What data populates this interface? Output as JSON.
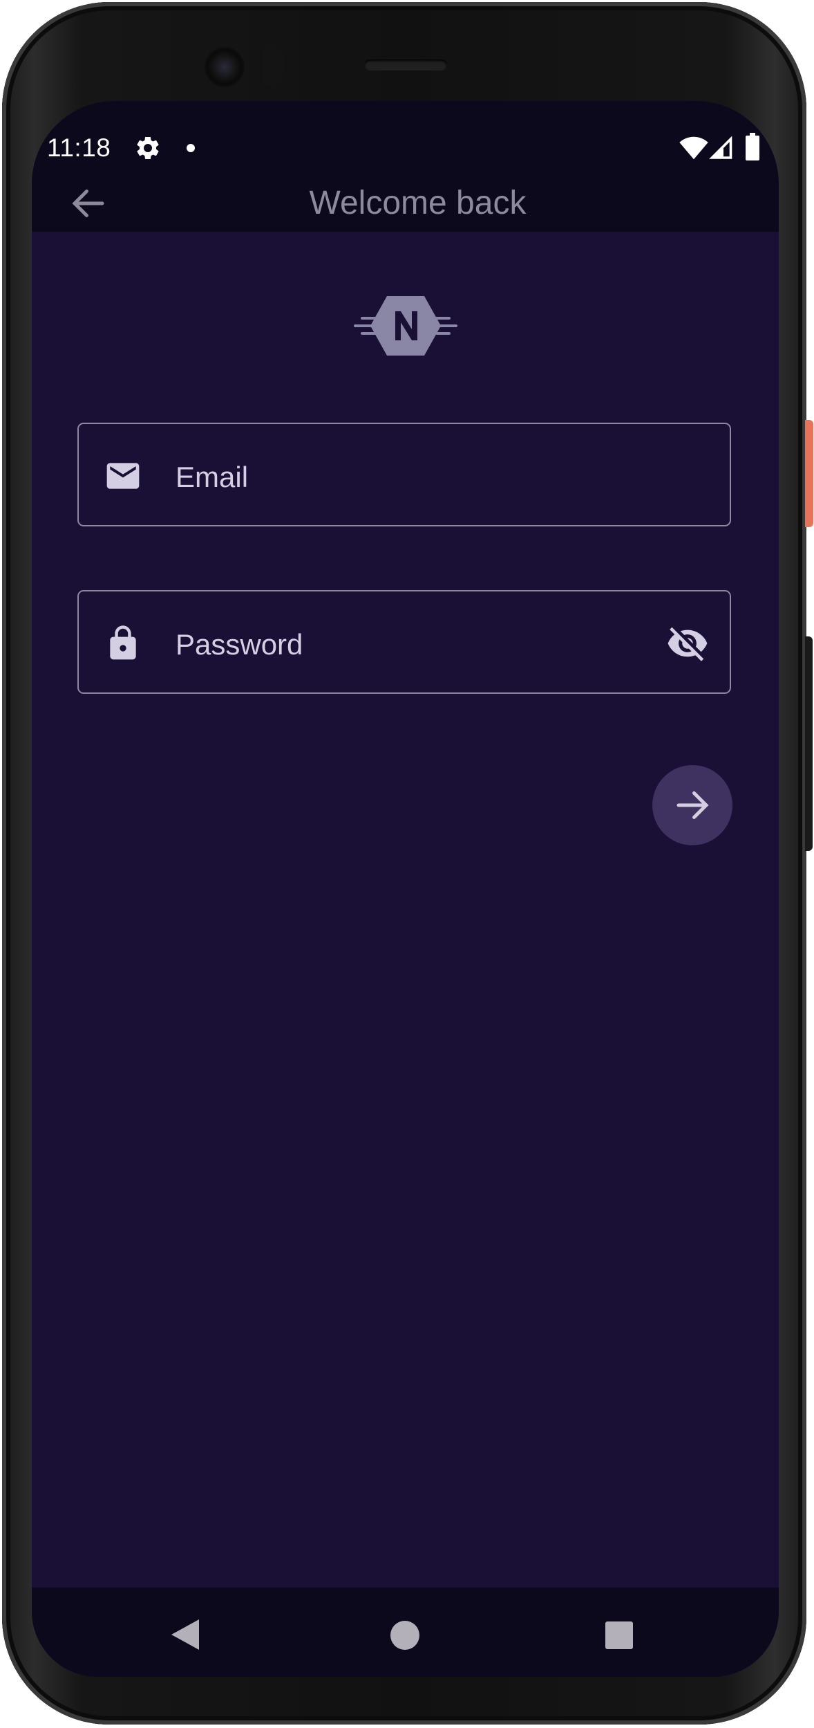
{
  "status_bar": {
    "time": "11:18",
    "icons": [
      "settings-gear-icon",
      "notification-dot-icon",
      "wifi-icon",
      "cell-signal-icon",
      "battery-icon"
    ]
  },
  "top_bar": {
    "back_icon": "arrow-back-icon",
    "title": "Welcome back"
  },
  "logo": {
    "letter": "N",
    "color": "#8a86a6"
  },
  "form": {
    "email": {
      "label": "Email",
      "icon": "mail-icon",
      "value": ""
    },
    "password": {
      "label": "Password",
      "icon": "lock-icon",
      "value": "",
      "toggle_icon": "visibility-off-icon"
    },
    "submit_icon": "arrow-forward-icon"
  },
  "nav_bar": {
    "icons": [
      "nav-back-icon",
      "nav-home-icon",
      "nav-recents-icon"
    ]
  },
  "colors": {
    "background": "#1a0f35",
    "bars": "#0d091d",
    "outline": "#8d88a2",
    "label": "#d4cfe3",
    "title": "#8e8a9c",
    "fab": "#3f3160",
    "accent_button": "#e7735a"
  }
}
